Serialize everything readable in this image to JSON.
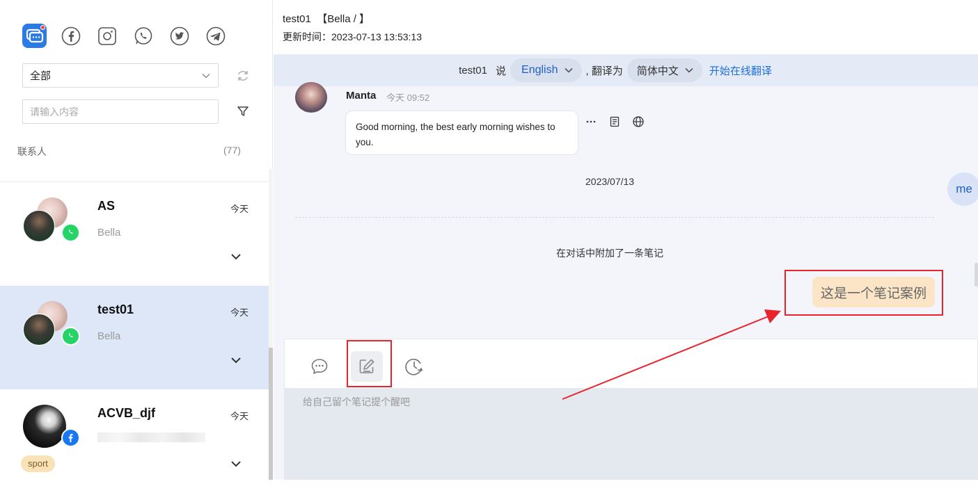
{
  "sidebar": {
    "platforms": [
      {
        "icon": "chat-app-icon",
        "active": true
      },
      {
        "icon": "facebook-icon"
      },
      {
        "icon": "instagram-icon"
      },
      {
        "icon": "whatsapp-icon"
      },
      {
        "icon": "twitter-icon"
      },
      {
        "icon": "telegram-icon"
      }
    ],
    "filter_select": {
      "value": "全部"
    },
    "search": {
      "placeholder": "请输入内容"
    },
    "contacts_label": "联系人",
    "contacts_count": "(77)",
    "contacts": [
      {
        "name": "AS",
        "subtitle": "Bella",
        "time": "今天",
        "channel": "whatsapp"
      },
      {
        "name": "test01",
        "subtitle": "Bella",
        "time": "今天",
        "channel": "whatsapp",
        "active": true
      },
      {
        "name": "ACVB_djf",
        "subtitle": "",
        "time": "今天",
        "channel": "facebook",
        "tag": "sport"
      }
    ]
  },
  "chat": {
    "header_title": "test01  【Bella / 】",
    "header_updated": "更新时间：2023-07-13 13:53:13",
    "translation": {
      "speaker": "test01",
      "says": "说",
      "source_lang": "English",
      "translate_to": ", 翻译为",
      "target_lang": "简体中文",
      "start_link": "开始在线翻译"
    },
    "incoming": {
      "sender": "Manta",
      "time": "今天 09:52",
      "text": "Good morning, the best early morning wishes to you."
    },
    "date_separator": "2023/07/13",
    "me_label": "me",
    "note_system_text": "在对话中附加了一条笔记",
    "note_text": "这是一个笔记案例",
    "composer": {
      "notes_placeholder": "给自己留个笔记提个醒吧",
      "tools": [
        "message-icon",
        "note-edit-icon",
        "schedule-icon"
      ]
    }
  },
  "colors": {
    "accent": "#1e5fc7",
    "active_row": "#dde7f8",
    "note_bubble": "#fbe5c6",
    "annotation_red": "#e8232b",
    "whatsapp": "#25d366",
    "facebook": "#1877f2"
  }
}
